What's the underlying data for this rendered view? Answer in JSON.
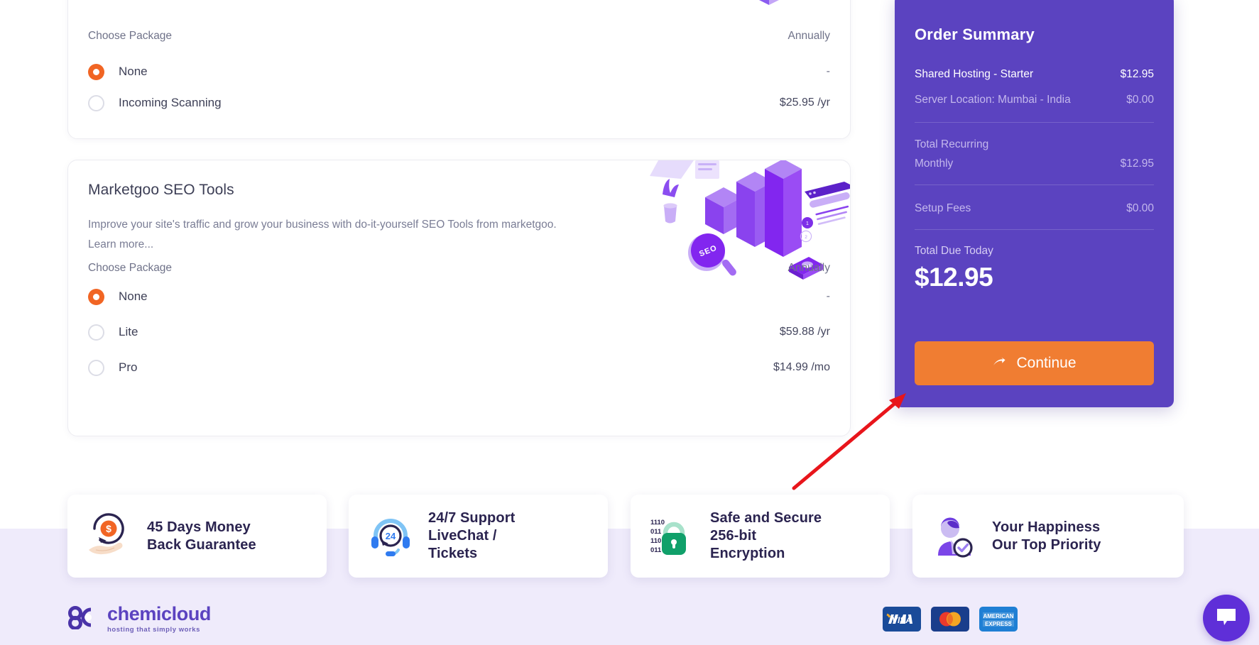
{
  "theme": {
    "brand_purple": "#5B43C0",
    "accent_orange": "#F16524",
    "button_orange": "#F07D32",
    "footer_bg": "#EFEBFB",
    "text_dark": "#3D3F56",
    "text_muted": "#7A7D95",
    "annotation_red": "#E8151B"
  },
  "spam_card": {
    "choose_package_label": "Choose Package",
    "billing_cycle": "Annually",
    "options": [
      {
        "label": "None",
        "price": "-",
        "selected": true
      },
      {
        "label": "Incoming Scanning",
        "price": "$25.95 /yr",
        "selected": false
      }
    ]
  },
  "seo_card": {
    "title": "Marketgoo SEO Tools",
    "description": "Improve your site's traffic and grow your business with do-it-yourself SEO Tools from marketgoo.",
    "learn_more": "Learn more...",
    "choose_package_label": "Choose Package",
    "billing_cycle": "Annually",
    "options": [
      {
        "label": "None",
        "price": "-",
        "selected": true
      },
      {
        "label": "Lite",
        "price": "$59.88 /yr",
        "selected": false
      },
      {
        "label": "Pro",
        "price": "$14.99 /mo",
        "selected": false
      }
    ]
  },
  "order_summary": {
    "title": "Order Summary",
    "lines": [
      {
        "label": "Shared Hosting - Starter",
        "value": "$12.95",
        "emphasis": "strong"
      },
      {
        "label": "Server Location: Mumbai - India",
        "value": "$0.00",
        "emphasis": "dim"
      }
    ],
    "recurring_heading": "Total Recurring",
    "recurring_line": {
      "label": "Monthly",
      "value": "$12.95"
    },
    "setup_fees": {
      "label": "Setup Fees",
      "value": "$0.00"
    },
    "total_due_label": "Total Due Today",
    "total_due_amount": "$12.95",
    "continue_label": "Continue",
    "continue_icon": "arrow-right-icon"
  },
  "trust_badges": [
    {
      "icon": "money-back-hand-icon",
      "line1": "45 Days Money",
      "line2": "Back Guarantee",
      "line3": ""
    },
    {
      "icon": "headset-24-icon",
      "line1": "24/7 Support",
      "line2": "LiveChat /",
      "line3": "Tickets"
    },
    {
      "icon": "green-padlock-icon",
      "line1": "Safe and Secure",
      "line2": "256-bit",
      "line3": "Encryption"
    },
    {
      "icon": "support-agent-check-icon",
      "line1": "Your Happiness",
      "line2": "Our Top Priority",
      "line3": ""
    }
  ],
  "footer": {
    "logo_name": "chemicloud",
    "logo_tagline": "hosting that simply works",
    "payment_methods": [
      "VISA",
      "Mastercard",
      "AMERICAN EXPRESS"
    ],
    "visa_label": "VISA",
    "amex_line1": "AMERICAN",
    "amex_line2": "EXPRESS",
    "chat_icon": "chat-bubble-icon"
  }
}
